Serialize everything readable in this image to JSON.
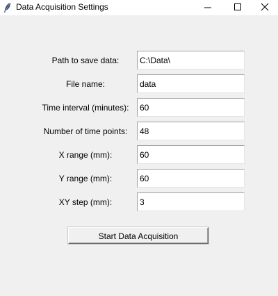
{
  "window": {
    "title": "Data Acquisition Settings",
    "icon": "feather-icon",
    "controls": [
      "minimize-icon",
      "maximize-icon",
      "close-icon"
    ]
  },
  "form": {
    "fields": [
      {
        "label": "Path to save data:",
        "value": "C:\\Data\\"
      },
      {
        "label": "File name:",
        "value": "data"
      },
      {
        "label": "Time interval (minutes):",
        "value": "60"
      },
      {
        "label": "Number of time points:",
        "value": "48"
      },
      {
        "label": "X range (mm):",
        "value": "60"
      },
      {
        "label": "Y range (mm):",
        "value": "60"
      },
      {
        "label": "XY step (mm):",
        "value": "3"
      }
    ],
    "start_button": "Start Data Acquisition"
  }
}
